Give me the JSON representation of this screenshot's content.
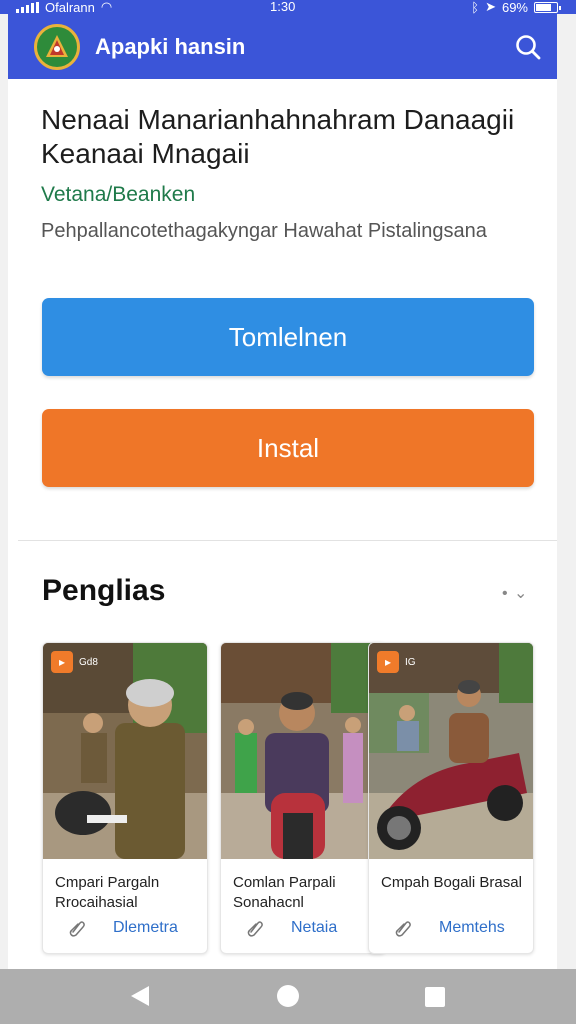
{
  "status_bar": {
    "carrier": "Ofalrann",
    "time": "1:30",
    "battery": "69%"
  },
  "app_bar": {
    "title": "Apapki hansin",
    "logo_icon": "emblem-icon",
    "search_icon": "search-icon"
  },
  "app": {
    "name": "Nenaai Manarianhahnahram Danaagii Keanaai Mnagaii",
    "developer": "Vetana/Beanken",
    "description": "Pehpallancotethagakyngar Hawahat Pistalingsana"
  },
  "buttons": {
    "open": "Tomlelnen",
    "install": "Instal"
  },
  "section": {
    "title": "Penglias",
    "more": "• ⌄"
  },
  "cards": [
    {
      "badge": "Gd8",
      "title": "Cmpari Pargaln Rrocaihasial",
      "link": "Dlemetra"
    },
    {
      "badge": "",
      "title": "Comlan Parpali Sonahacnl",
      "link": "Netaia"
    },
    {
      "badge": "IG",
      "title": "Cmpah Bogali Brasal",
      "link": "Memtehs"
    }
  ],
  "colors": {
    "app_bar": "#3b55d8",
    "open_button": "#2f8ee3",
    "install_button": "#ef7628",
    "developer_text": "#1f7a4a",
    "link_text": "#2f6fc9"
  },
  "nav_bar": {
    "back_icon": "back-icon",
    "home_icon": "home-icon",
    "recent_icon": "recent-apps-icon"
  }
}
